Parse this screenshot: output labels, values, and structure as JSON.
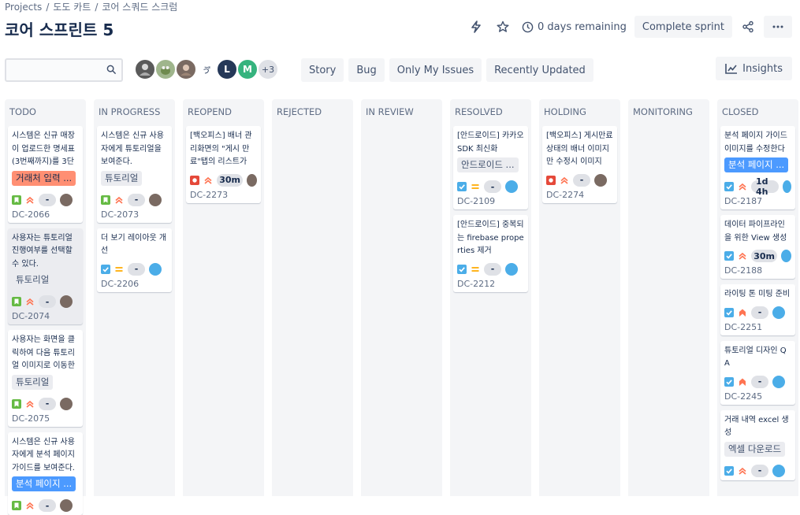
{
  "breadcrumbs": [
    "Projects",
    "도도 카트",
    "코어 스쿼드 스크럼"
  ],
  "title": "코어 스프린트 5",
  "header": {
    "remaining": "0 days remaining",
    "complete_sprint": "Complete sprint"
  },
  "search": {
    "placeholder": ""
  },
  "avatars": {
    "more_label": "+3",
    "letters": [
      "L",
      "M"
    ],
    "squiggle": "ゔ゙"
  },
  "filters": [
    "Story",
    "Bug",
    "Only My Issues",
    "Recently Updated"
  ],
  "insights_label": "Insights",
  "colors": {
    "story": "#65ba43",
    "task": "#4bade8",
    "bug": "#e5493a",
    "high": "#ff7452",
    "medium": "#ffab00"
  },
  "columns": [
    {
      "name": "TODO",
      "cards": [
        {
          "summary": "시스템은 신규 매장이 업로드한 명세표(3번째까지)를 3단",
          "epic": "거래처 입력 ...",
          "type": "story",
          "priority": "high",
          "est": "-",
          "key": "DC-2066"
        },
        {
          "summary": "사용자는 튜토리얼 진행여부를 선택할 수 있다.",
          "epic": "튜토리얼",
          "type": "story",
          "priority": "high",
          "est": "-",
          "key": "DC-2074",
          "flag": true
        },
        {
          "summary": "사용자는 화면을 클릭하여 다음 튜토리얼 이미지로 이동한",
          "epic": "튜토리얼",
          "type": "story",
          "priority": "high",
          "est": "-",
          "key": "DC-2075"
        },
        {
          "summary": "시스템은 신규 사용자에게 분석 페이지 가이드를 보여준다.",
          "epic": "분석 페이지 ...",
          "type": "story",
          "priority": "high",
          "est": "-",
          "key": ""
        }
      ]
    },
    {
      "name": "IN PROGRESS",
      "cards": [
        {
          "summary": "시스템은 신규 사용자에게 튜토리얼을 보여준다.",
          "epic": "튜토리얼",
          "type": "story",
          "priority": "high",
          "est": "-",
          "key": "DC-2073"
        },
        {
          "summary": "더 보기 레이아웃 개선",
          "epic": "",
          "type": "task",
          "priority": "medium",
          "est": "-",
          "key": "DC-2206"
        }
      ]
    },
    {
      "name": "REOPEND",
      "cards": [
        {
          "summary": "[백오피스] 배너 관리화면의 \"게시 만료\"탭의 리스트가",
          "epic": "",
          "type": "bug",
          "priority": "high",
          "est": "30m",
          "key": "DC-2273"
        }
      ]
    },
    {
      "name": "REJECTED",
      "cards": []
    },
    {
      "name": "IN REVIEW",
      "cards": []
    },
    {
      "name": "RESOLVED",
      "cards": [
        {
          "summary": "[안드로이드] 카카오 SDK 최신화",
          "epic": "안드로이드 ...",
          "type": "task",
          "priority": "medium",
          "est": "-",
          "key": "DC-2109"
        },
        {
          "summary": "[안드로이드] 중복되는 firebase properties 제거",
          "epic": "",
          "type": "task",
          "priority": "medium",
          "est": "-",
          "key": "DC-2212"
        }
      ]
    },
    {
      "name": "HOLDING",
      "cards": [
        {
          "summary": "[백오피스] 게시만료 상태의 배너 이미지만 수정시 이미지",
          "epic": "",
          "type": "bug",
          "priority": "high",
          "est": "-",
          "key": "DC-2274"
        }
      ]
    },
    {
      "name": "MONITORING",
      "cards": []
    },
    {
      "name": "CLOSED",
      "cards": [
        {
          "summary": "분석 페이지 가이드 이미지를 수정한다",
          "epic": "분석 페이지 ...",
          "type": "task",
          "priority": "high",
          "est": "1d 4h",
          "key": "DC-2187"
        },
        {
          "summary": "데이터 파이프라인을 위한 View 생성",
          "epic": "",
          "type": "task",
          "priority": "high",
          "est": "30m",
          "key": "DC-2188"
        },
        {
          "summary": "라이팅 톤 미팅 준비",
          "epic": "",
          "type": "task",
          "priority": "highest",
          "est": "-",
          "key": "DC-2251"
        },
        {
          "summary": "튜토리얼 디자인 QA",
          "epic": "",
          "type": "task",
          "priority": "highest",
          "est": "-",
          "key": "DC-2245"
        },
        {
          "summary": "거래 내역 excel 생성",
          "epic": "엑셀 다운로드",
          "type": "task",
          "priority": "high",
          "est": "-",
          "key": ""
        }
      ]
    }
  ]
}
